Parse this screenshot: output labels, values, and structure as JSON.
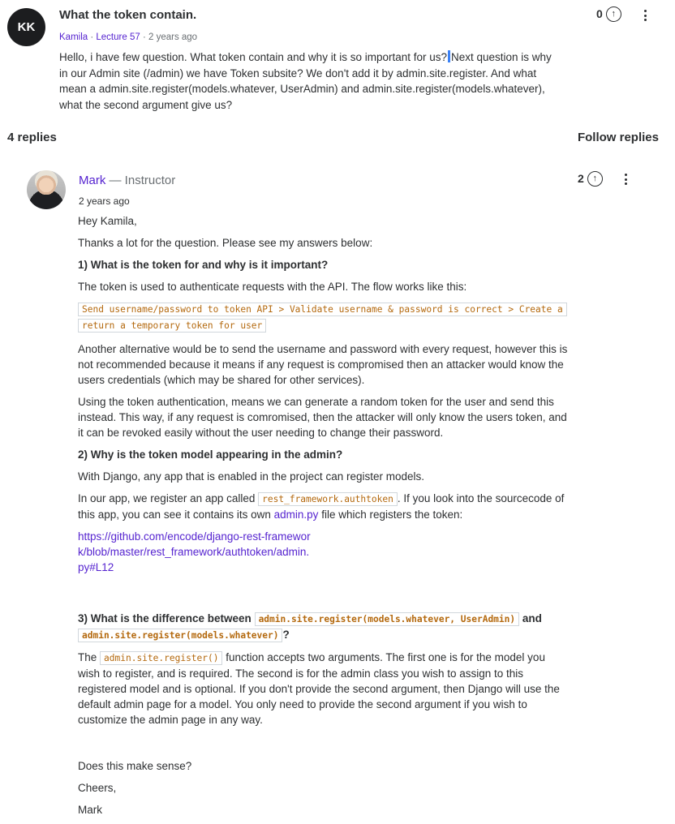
{
  "question": {
    "avatar_initials": "KK",
    "title": "What the token contain.",
    "author": "Kamila",
    "lecture": "Lecture 57",
    "time": "2 years ago",
    "body_1": "Hello, i have few question. What token contain and why it is so important for us?",
    "body_2": "Next question is why in our Admin site (/admin) we have Token subsite? We don't add it by admin.site.register. And what mean a admin.site.register(models.whatever, UserAdmin) and admin.site.register(models.whatever), what the second argument give us?",
    "votes": "0"
  },
  "replies_count": "4 replies",
  "follow_label": "Follow replies",
  "reply": {
    "author": "Mark",
    "role": "— Instructor",
    "time": "2 years ago",
    "votes": "2",
    "greeting": "Hey Kamila,",
    "intro": "Thanks a lot for the question. Please see my answers below:",
    "h1": "1) What is the token for and why is it important?",
    "p1": "The token is used to authenticate requests with the API. The flow works like this:",
    "flow": "Send username/password to token API > Validate username & password is correct > Create a return a temporary token for user",
    "p2": "Another alternative would be to send the username and password with every request, however this is not recommended because it means if any request is compromised then an attacker would know the users credentials (which may be shared for other services).",
    "p3": "Using the token authentication, means we can generate a random token for the user and send this instead. This way, if any request is comromised, then the attacker will only know the users token, and it can be revoked easily without the user needing to change their password.",
    "h2": "2) Why is the token model appearing in the admin?",
    "p4": "With Django, any app that is enabled in the project can register models.",
    "p5_a": "In our app, we register an app called",
    "p5_code": "rest_framework.authtoken",
    "p5_b": ". If you look into the sourcecode of this app, you can see it contains its own",
    "p5_link": "admin.py",
    "p5_c": "file which registers the token:",
    "url": "https://github.com/encode/django-rest-framework/blob/master/rest_framework/authtoken/admin.py#L12",
    "h3_a": "3) What is the difference between",
    "h3_code1": "admin.site.register(models.whatever, UserAdmin)",
    "h3_b": "and",
    "h3_code2": "admin.site.register(models.whatever)",
    "h3_c": "?",
    "p6_a": "The",
    "p6_code": "admin.site.register()",
    "p6_b": "function accepts two arguments. The first one is for the model you wish to register, and is required. The second is for the admin class you wish to assign to this registered model and is optional. If you don't provide the second argument, then Django will use the default admin page for a model. You only need to provide the second argument if you wish to customize the admin page in any way.",
    "p7": "Does this make sense?",
    "p8": "Cheers,",
    "p9": "Mark"
  },
  "icons": {
    "upvote": "arrow-up-circle-icon",
    "menu": "kebab-menu-icon"
  }
}
